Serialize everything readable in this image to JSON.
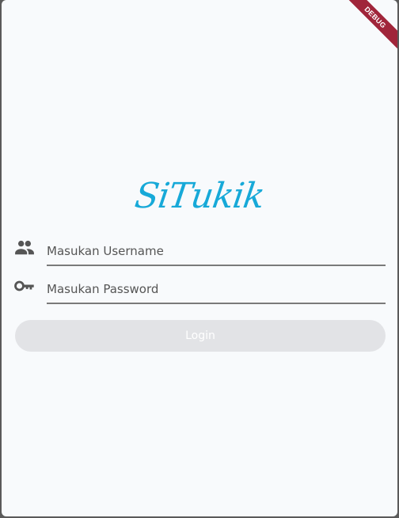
{
  "debug_banner": "DEBUG",
  "app": {
    "logo_text": "SiTukik"
  },
  "form": {
    "username": {
      "placeholder": "Masukan Username",
      "value": "",
      "icon": "people-icon"
    },
    "password": {
      "placeholder": "Masukan Password",
      "value": "",
      "icon": "key-icon"
    },
    "login_label": "Login"
  },
  "colors": {
    "logo": "#17a9d8",
    "background": "#f8fafc",
    "button_disabled": "#e2e3e6",
    "ribbon": "#a0253a"
  }
}
